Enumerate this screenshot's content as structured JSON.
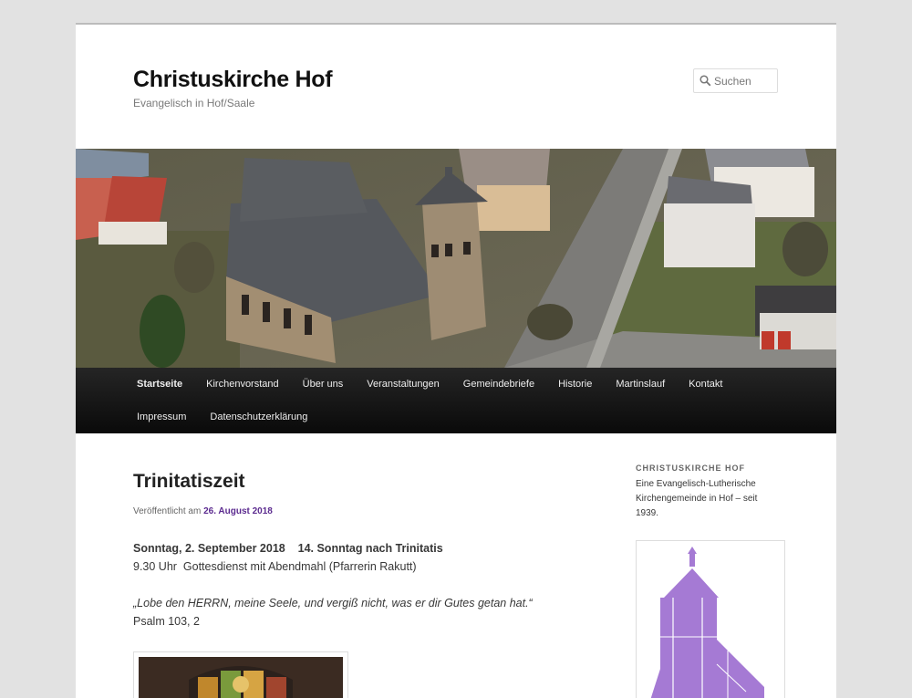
{
  "site": {
    "title": "Christuskirche Hof",
    "description": "Evangelisch in Hof/Saale"
  },
  "search": {
    "placeholder": "Suchen"
  },
  "nav": {
    "items": [
      {
        "label": "Startseite"
      },
      {
        "label": "Kirchenvorstand"
      },
      {
        "label": "Über uns"
      },
      {
        "label": "Veranstaltungen"
      },
      {
        "label": "Gemeindebriefe"
      },
      {
        "label": "Historie"
      },
      {
        "label": "Martinslauf"
      },
      {
        "label": "Kontakt"
      },
      {
        "label": "Impressum"
      },
      {
        "label": "Datenschutzerklärung"
      }
    ]
  },
  "post": {
    "title": "Trinitatiszeit",
    "meta_prefix": "Veröffentlicht am",
    "date": "26. August 2018",
    "service_heading": "Sonntag, 2. September 2018    14. Sonntag nach Trinitatis",
    "service_line": "9.30 Uhr  Gottesdienst mit Abendmahl (Pfarrerin Rakutt)",
    "quote": "„Lobe den HERRN, meine Seele, und vergiß nicht, was er dir Gutes getan hat.“",
    "quote_ref": "Psalm 103, 2"
  },
  "sidebar": {
    "widget_title": "Christuskirche Hof",
    "widget_text": "Eine Evangelisch-Lutherische Kirchengemeinde in Hof – seit 1939."
  },
  "colors": {
    "background": "#e2e2e2",
    "nav_bg": "#111111",
    "link_purple": "#5b2a8f",
    "logo_purple": "#a57ad4"
  },
  "icons": {
    "search": "search-icon"
  }
}
